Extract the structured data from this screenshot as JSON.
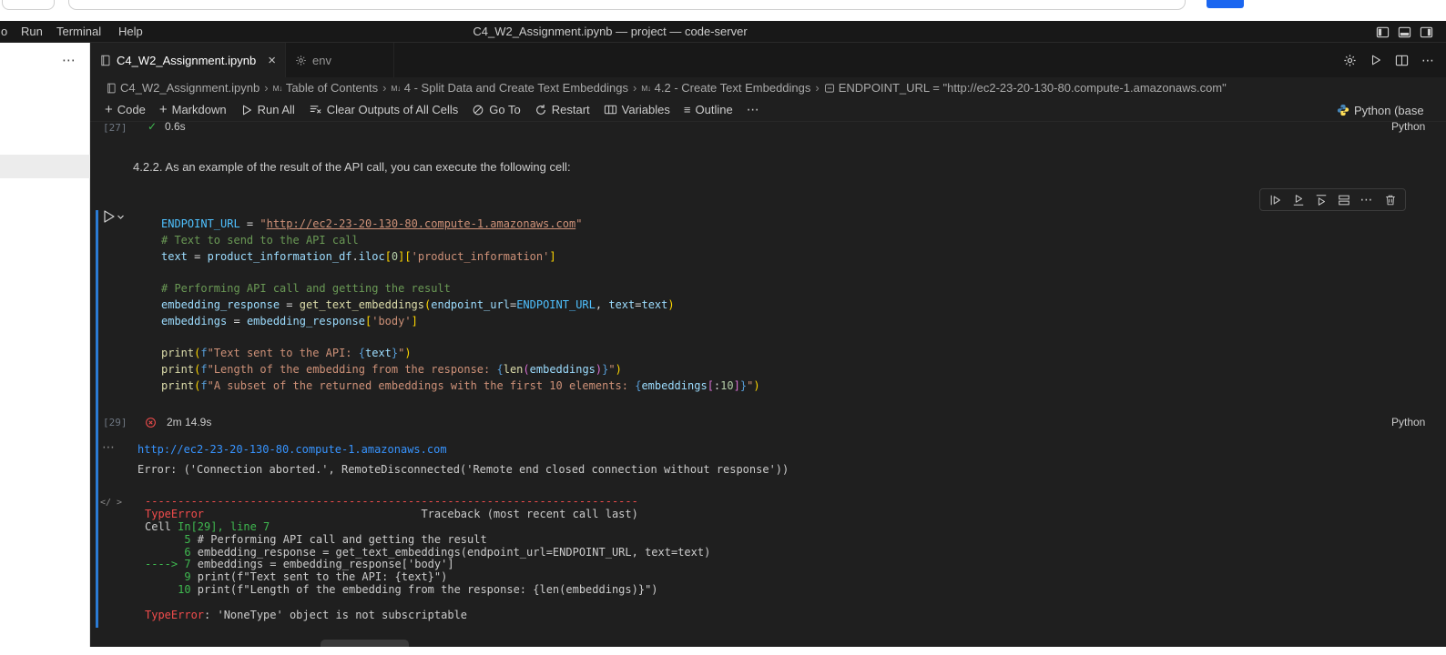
{
  "glyphs": {
    "more": "⋯",
    "check": "✓",
    "close": "×",
    "plus": "+",
    "outline": "≡",
    "separator": "›",
    "markdown": "M↓",
    "code_output": "</ >"
  },
  "titlebar": {
    "menus": [
      "o",
      "Run",
      "Terminal",
      "Help"
    ],
    "title": "C4_W2_Assignment.ipynb — project — code-server"
  },
  "tabs": [
    {
      "label": "C4_W2_Assignment.ipynb"
    },
    {
      "label": "env"
    }
  ],
  "breadcrumbs": [
    "C4_W2_Assignment.ipynb",
    "Table of Contents",
    "4 - Split Data and Create Text Embeddings",
    "4.2 - Create Text Embeddings",
    "ENDPOINT_URL = \"http://ec2-23-20-130-80.compute-1.amazonaws.com\""
  ],
  "notebook_toolbar": {
    "items": [
      {
        "label": "Code"
      },
      {
        "label": "Markdown"
      },
      {
        "label": "Run All"
      },
      {
        "label": "Clear Outputs of All Cells"
      },
      {
        "label": "Go To"
      },
      {
        "label": "Restart"
      },
      {
        "label": "Variables"
      },
      {
        "label": "Outline"
      }
    ],
    "kernel": "Python (base"
  },
  "previous_cell": {
    "execution_count": "[27]",
    "duration": "0.6s",
    "language": "Python"
  },
  "markdown_cell": {
    "text": "4.2.2. As an example of the result of the API call, you can execute the following cell:"
  },
  "code_cell": {
    "execution_count": "[29]",
    "duration": "2m 14.9s",
    "language": "Python",
    "lines": [
      [
        [
          "cv",
          "ENDPOINT_URL"
        ],
        [
          "p",
          " = "
        ],
        [
          "s",
          "\""
        ],
        [
          "su",
          "http://ec2-23-20-130-80.compute-1.amazonaws.com"
        ],
        [
          "s",
          "\""
        ]
      ],
      [
        [
          "c",
          "# Text to send to the API call"
        ]
      ],
      [
        [
          "v",
          "text"
        ],
        [
          "p",
          " = "
        ],
        [
          "v",
          "product_information_df"
        ],
        [
          "p",
          "."
        ],
        [
          "v",
          "iloc"
        ],
        [
          "b",
          "["
        ],
        [
          "n",
          "0"
        ],
        [
          "b",
          "]"
        ],
        [
          "b",
          "["
        ],
        [
          "s",
          "'product_information'"
        ],
        [
          "b",
          "]"
        ]
      ],
      [],
      [
        [
          "c",
          "# Performing API call and getting the result"
        ]
      ],
      [
        [
          "v",
          "embedding_response"
        ],
        [
          "p",
          " = "
        ],
        [
          "f",
          "get_text_embeddings"
        ],
        [
          "b",
          "("
        ],
        [
          "v",
          "endpoint_url"
        ],
        [
          "p",
          "="
        ],
        [
          "cv",
          "ENDPOINT_URL"
        ],
        [
          "p",
          ", "
        ],
        [
          "v",
          "text"
        ],
        [
          "p",
          "="
        ],
        [
          "v",
          "text"
        ],
        [
          "b",
          ")"
        ]
      ],
      [
        [
          "v",
          "embeddings"
        ],
        [
          "p",
          " = "
        ],
        [
          "v",
          "embedding_response"
        ],
        [
          "b",
          "["
        ],
        [
          "s",
          "'body'"
        ],
        [
          "b",
          "]"
        ]
      ],
      [],
      [
        [
          "f",
          "print"
        ],
        [
          "b",
          "("
        ],
        [
          "k",
          "f"
        ],
        [
          "s",
          "\"Text sent to the API: "
        ],
        [
          "k",
          "{"
        ],
        [
          "v",
          "text"
        ],
        [
          "k",
          "}"
        ],
        [
          "s",
          "\""
        ],
        [
          "b",
          ")"
        ]
      ],
      [
        [
          "f",
          "print"
        ],
        [
          "b",
          "("
        ],
        [
          "k",
          "f"
        ],
        [
          "s",
          "\"Length of the embedding from the response: "
        ],
        [
          "k",
          "{"
        ],
        [
          "f",
          "len"
        ],
        [
          "b2",
          "("
        ],
        [
          "v",
          "embeddings"
        ],
        [
          "b2",
          ")"
        ],
        [
          "k",
          "}"
        ],
        [
          "s",
          "\""
        ],
        [
          "b",
          ")"
        ]
      ],
      [
        [
          "f",
          "print"
        ],
        [
          "b",
          "("
        ],
        [
          "k",
          "f"
        ],
        [
          "s",
          "\"A subset of the returned embeddings with the first 10 elements: "
        ],
        [
          "k",
          "{"
        ],
        [
          "v",
          "embeddings"
        ],
        [
          "b2",
          "["
        ],
        [
          "p",
          ":"
        ],
        [
          "n",
          "10"
        ],
        [
          "b2",
          "]"
        ],
        [
          "k",
          "}"
        ],
        [
          "s",
          "\""
        ],
        [
          "b",
          ")"
        ]
      ]
    ]
  },
  "output": {
    "link": "http://ec2-23-20-130-80.compute-1.amazonaws.com",
    "error_line": "Error: ('Connection aborted.', RemoteDisconnected('Remote end closed connection without response'))",
    "traceback": [
      [
        [
          "r",
          "---------------------------------------------------------------------------"
        ]
      ],
      [
        [
          "r",
          "TypeError"
        ],
        [
          "w",
          "                                 Traceback (most recent call last)"
        ]
      ],
      [
        [
          "w",
          "Cell "
        ],
        [
          "g",
          "In[29], line 7"
        ]
      ],
      [
        [
          "g",
          "      5"
        ],
        [
          "w",
          " # Performing API call and getting the result"
        ]
      ],
      [
        [
          "g",
          "      6"
        ],
        [
          "w",
          " embedding_response = get_text_embeddings(endpoint_url=ENDPOINT_URL, text=text)"
        ]
      ],
      [
        [
          "g",
          "----> 7"
        ],
        [
          "w",
          " embeddings = embedding_response['body']"
        ]
      ],
      [
        [
          "g",
          "      9"
        ],
        [
          "w",
          " print(f\"Text sent to the API: {text}\")"
        ]
      ],
      [
        [
          "g",
          "     10"
        ],
        [
          "w",
          " print(f\"Length of the embedding from the response: {len(embeddings)}\")"
        ]
      ],
      [],
      [
        [
          "r",
          "TypeError"
        ],
        [
          "w",
          ": 'NoneType' object is not subscriptable"
        ]
      ]
    ]
  }
}
